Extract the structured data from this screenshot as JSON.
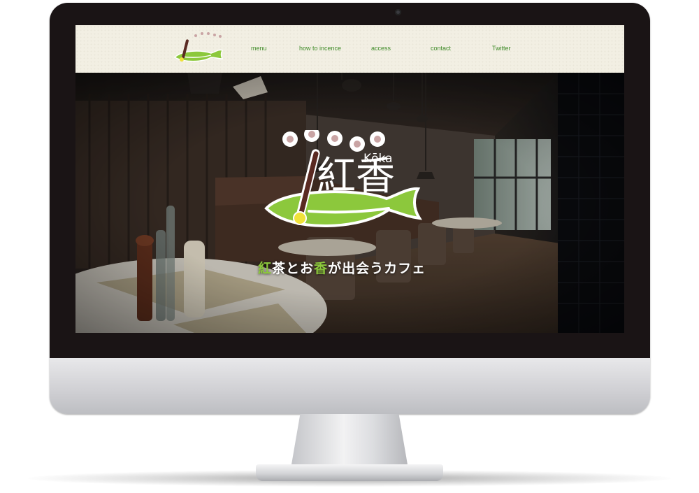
{
  "site": {
    "brand_name": "紅香",
    "brand_romaji": "Kōka",
    "tagline_parts": [
      "紅",
      "茶と",
      "お",
      "香",
      "が出会うカフェ"
    ]
  },
  "nav": {
    "items": [
      {
        "label": "menu"
      },
      {
        "label": "how to incence"
      },
      {
        "label": "access"
      },
      {
        "label": "contact"
      },
      {
        "label": "Twitter"
      }
    ]
  },
  "colors": {
    "accent_green": "#8cc83c",
    "nav_green": "#3f8b28",
    "header_bg": "#f2efe3",
    "incense_stick": "#5a2a22",
    "smoke_dots": "#c9a4a4"
  },
  "icons": {
    "logo": "incense-leaf-logo"
  }
}
